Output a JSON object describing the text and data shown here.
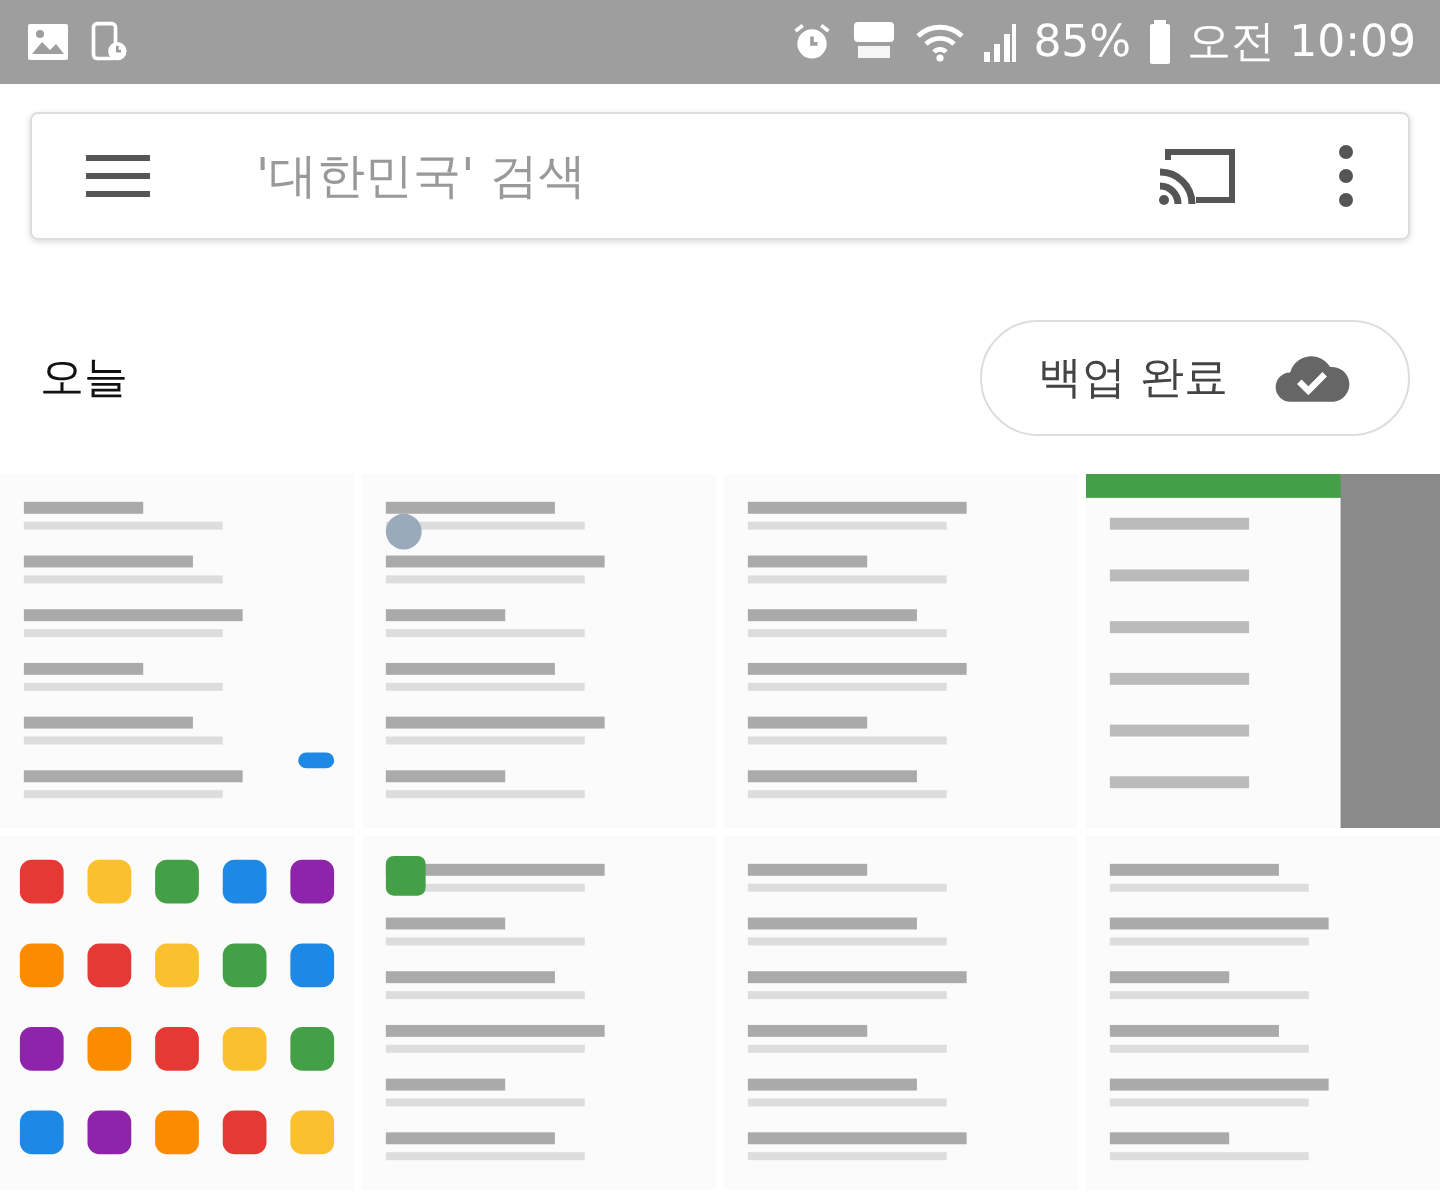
{
  "status_bar": {
    "battery": "85%",
    "time": "오전 10:09"
  },
  "search": {
    "placeholder": "'대한민국' 검색"
  },
  "section": {
    "title": "오늘"
  },
  "backup_button": {
    "label": "백업 완료"
  }
}
